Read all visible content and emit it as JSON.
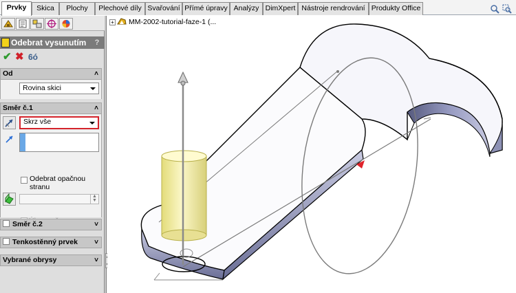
{
  "tabs": [
    "Prvky",
    "Skica",
    "Plochy",
    "Plechové díly",
    "Svařování",
    "Přímé úpravy",
    "Analýzy",
    "DimXpert",
    "Nástroje rendrování",
    "Produkty Office"
  ],
  "view_icons": [
    "zoom-to-fit-icon",
    "zoom-area-icon"
  ],
  "pm_tabs": [
    "featuremanager-tab-icon",
    "propertymanager-tab-icon",
    "configurationmanager-tab-icon",
    "dimxpert-tab-icon",
    "display-manager-tab-icon"
  ],
  "feature": {
    "title": "Odebrat vysunutím",
    "help": "?",
    "ok": "✔",
    "cancel": "✖",
    "preview": "6ó"
  },
  "groups": {
    "od": {
      "title": "Od",
      "value": "Rovina skici"
    },
    "smer1": {
      "title": "Směr č.1",
      "end_condition": "Skrz vše",
      "flip_side_label": "Odebrat opačnou stranu",
      "flip_side_checked": false,
      "draft_label": "Úkos vně"
    },
    "smer2": {
      "title": "Směr č.2",
      "checked": false
    },
    "thin": {
      "title": "Tenkostěnný prvek",
      "checked": false
    },
    "contours": {
      "title": "Vybrané obrysy"
    }
  },
  "tree": {
    "expand": "+",
    "part_name": "MM-2002-tutorial-faze-1  (..."
  },
  "colors": {
    "highlight_border": "#d4232b",
    "title_bar": "#7b7b7b",
    "ok_green": "#2e9a2e",
    "cancel_red": "#d0202a",
    "cylinder_yellow": "#f5f0a8"
  }
}
